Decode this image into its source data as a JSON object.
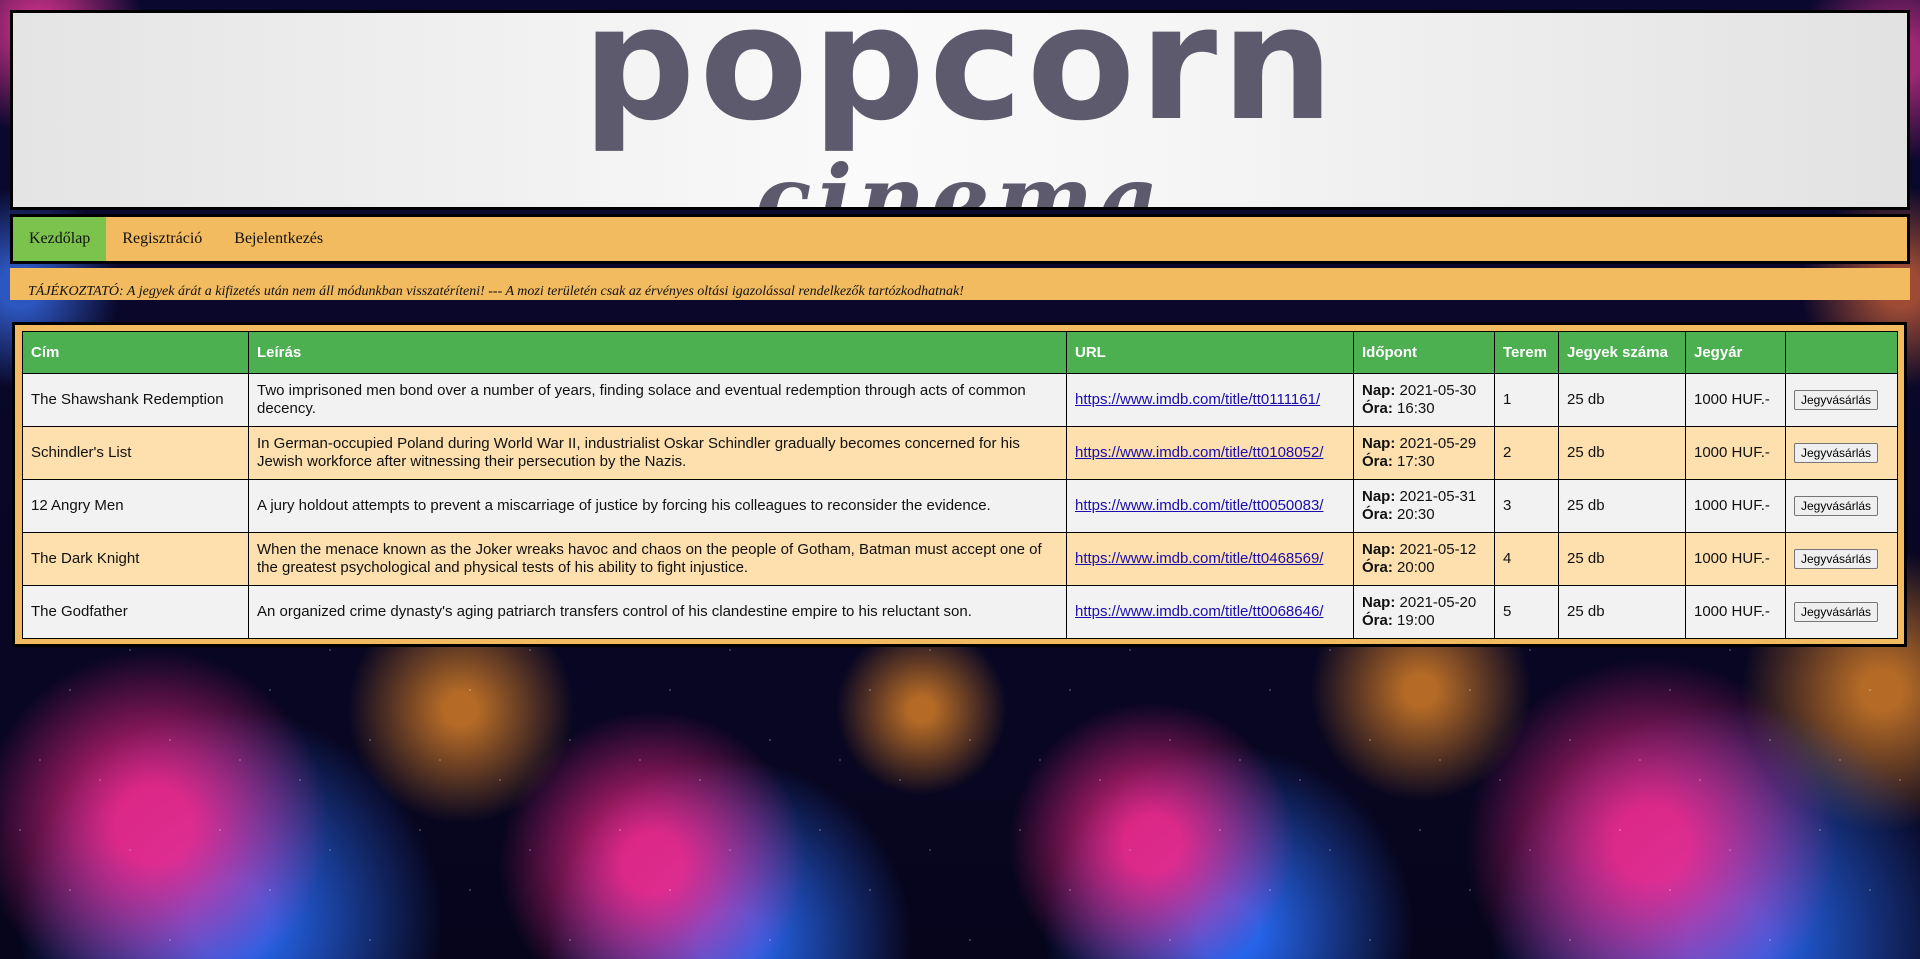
{
  "header": {
    "brand": "popcorn",
    "brand_sub": "cinema"
  },
  "nav": {
    "items": [
      {
        "label": "Kezdőlap",
        "active": true
      },
      {
        "label": "Regisztráció",
        "active": false
      },
      {
        "label": "Bejelentkezés",
        "active": false
      }
    ]
  },
  "notice": {
    "text": "TÁJÉKOZTATÓ: A jegyek árát a kifizetés után nem áll módunkban visszatéríteni! --- A mozi területén csak az érvényes oltási igazolással rendelkezők tartózkodhatnak!"
  },
  "table": {
    "headers": [
      "Cím",
      "Leírás",
      "URL",
      "Időpont",
      "Terem",
      "Jegyek száma",
      "Jegyár",
      ""
    ],
    "day_label": "Nap:",
    "time_label": "Óra:",
    "rows": [
      {
        "title": "The Shawshank Redemption",
        "description": "Two imprisoned men bond over a number of years, finding solace and eventual redemption through acts of common decency.",
        "url": "https://www.imdb.com/title/tt0111161/",
        "day": "2021-05-30",
        "time": "16:30",
        "room": "1",
        "tickets": "25 db",
        "price": "1000 HUF.-",
        "button": "Jegyvásárlás"
      },
      {
        "title": "Schindler's List",
        "description": "In German-occupied Poland during World War II, industrialist Oskar Schindler gradually becomes concerned for his Jewish workforce after witnessing their persecution by the Nazis.",
        "url": "https://www.imdb.com/title/tt0108052/",
        "day": "2021-05-29",
        "time": "17:30",
        "room": "2",
        "tickets": "25 db",
        "price": "1000 HUF.-",
        "button": "Jegyvásárlás"
      },
      {
        "title": "12 Angry Men",
        "description": "A jury holdout attempts to prevent a miscarriage of justice by forcing his colleagues to reconsider the evidence.",
        "url": "https://www.imdb.com/title/tt0050083/",
        "day": "2021-05-31",
        "time": "20:30",
        "room": "3",
        "tickets": "25 db",
        "price": "1000 HUF.-",
        "button": "Jegyvásárlás"
      },
      {
        "title": "The Dark Knight",
        "description": "When the menace known as the Joker wreaks havoc and chaos on the people of Gotham, Batman must accept one of the greatest psychological and physical tests of his ability to fight injustice.",
        "url": "https://www.imdb.com/title/tt0468569/",
        "day": "2021-05-12",
        "time": "20:00",
        "room": "4",
        "tickets": "25 db",
        "price": "1000 HUF.-",
        "button": "Jegyvásárlás"
      },
      {
        "title": "The Godfather",
        "description": "An organized crime dynasty's aging patriarch transfers control of his clandestine empire to his reluctant son.",
        "url": "https://www.imdb.com/title/tt0068646/",
        "day": "2021-05-20",
        "time": "19:00",
        "room": "5",
        "tickets": "25 db",
        "price": "1000 HUF.-",
        "button": "Jegyvásárlás"
      }
    ]
  },
  "colors": {
    "nav_bg": "#f3bb5f",
    "nav_active": "#7cc34e",
    "table_header": "#4caf50",
    "row_odd": "#f2f2f2",
    "row_even": "#fde0ad"
  }
}
